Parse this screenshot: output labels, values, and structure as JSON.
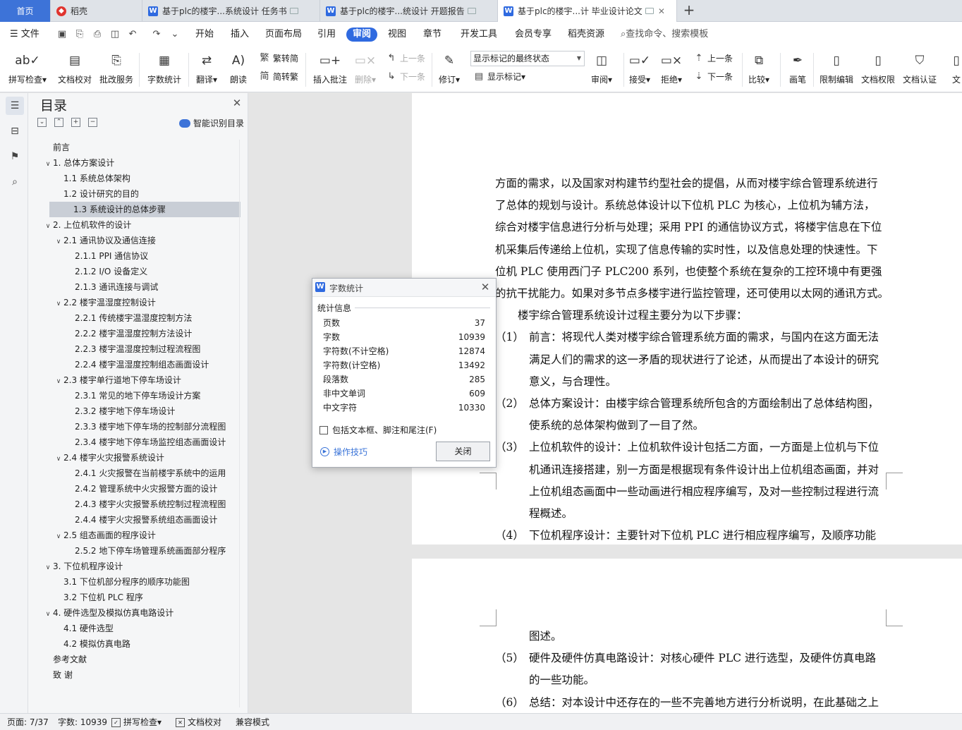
{
  "tabs": [
    {
      "label": "首页",
      "icon": "home"
    },
    {
      "label": "稻壳",
      "icon": "docer-icon"
    },
    {
      "label": "基于plc的楼宇...系统设计 任务书",
      "icon": "word-doc-icon"
    },
    {
      "label": "基于plc的楼宇...统设计 开题报告",
      "icon": "word-doc-icon"
    },
    {
      "label": "基于plc的楼宇...计 毕业设计论文",
      "icon": "word-doc-icon"
    }
  ],
  "menu": {
    "file": "文件",
    "items": [
      "开始",
      "插入",
      "页面布局",
      "引用",
      "审阅",
      "视图",
      "章节",
      "开发工具",
      "会员专享",
      "稻壳资源"
    ],
    "active": "审阅",
    "search": "查找命令、搜索模板"
  },
  "ribbon": {
    "spellcheck": "拼写检查",
    "doc_proof": "文档校对",
    "batch_review": "批改服务",
    "word_count": "字数统计",
    "translate": "翻译",
    "read_aloud": "朗读",
    "trad_convert": "繁转简",
    "simp_convert": "简转繁",
    "insert_comment": "插入批注",
    "delete": "删除",
    "prev_comment": "上一条",
    "next_comment": "下一条",
    "track_changes": "修订",
    "markup_state": "显示标记的最终状态",
    "show_markup": "显示标记",
    "review": "审阅",
    "accept": "接受",
    "reject": "拒绝",
    "prev_change": "上一条",
    "next_change": "下一条",
    "compare": "比较",
    "pen": "画笔",
    "restrict_edit": "限制编辑",
    "doc_rights": "文档权限",
    "doc_cert": "文档认证",
    "doc_more": "文"
  },
  "toc": {
    "title": "目录",
    "smart": "智能识别目录",
    "items": [
      {
        "text": "前言",
        "level": 0,
        "caret": false
      },
      {
        "text": "1. 总体方案设计",
        "level": 0,
        "caret": true
      },
      {
        "text": "1.1  系统总体架构",
        "level": 1,
        "caret": false
      },
      {
        "text": "1.2  设计研究的目的",
        "level": 1,
        "caret": false
      },
      {
        "text": "1.3  系统设计的总体步骤",
        "level": 1,
        "caret": false,
        "selected": true
      },
      {
        "text": "2. 上位机软件的设计",
        "level": 0,
        "caret": true
      },
      {
        "text": "2.1  通讯协议及通信连接",
        "level": 1,
        "caret": true
      },
      {
        "text": "2.1.1 PPI 通信协议",
        "level": 2,
        "caret": false
      },
      {
        "text": "2.1.2 I/O 设备定义",
        "level": 2,
        "caret": false
      },
      {
        "text": "2.1.3  通讯连接与调试",
        "level": 2,
        "caret": false
      },
      {
        "text": "2.2  楼宇温湿度控制设计",
        "level": 1,
        "caret": true
      },
      {
        "text": "2.2.1  传统楼宇温湿度控制方法",
        "level": 2,
        "caret": false
      },
      {
        "text": "2.2.2  楼宇温湿度控制方法设计",
        "level": 2,
        "caret": false
      },
      {
        "text": "2.2.3  楼宇温湿度控制过程流程图",
        "level": 2,
        "caret": false
      },
      {
        "text": "2.2.4  楼宇温湿度控制组态画面设计",
        "level": 2,
        "caret": false
      },
      {
        "text": "2.3  楼宇单行道地下停车场设计",
        "level": 1,
        "caret": true
      },
      {
        "text": "2.3.1  常见的地下停车场设计方案",
        "level": 2,
        "caret": false
      },
      {
        "text": "2.3.2  楼宇地下停车场设计",
        "level": 2,
        "caret": false
      },
      {
        "text": "2.3.3  楼宇地下停车场的控制部分流程图",
        "level": 2,
        "caret": false
      },
      {
        "text": "2.3.4  楼宇地下停车场监控组态画面设计",
        "level": 2,
        "caret": false
      },
      {
        "text": "2.4  楼宇火灾报警系统设计",
        "level": 1,
        "caret": true
      },
      {
        "text": "2.4.1  火灾报警在当前楼宇系统中的运用",
        "level": 2,
        "caret": false
      },
      {
        "text": "2.4.2  管理系统中火灾报警方面的设计",
        "level": 2,
        "caret": false
      },
      {
        "text": "2.4.3  楼宇火灾报警系统控制过程流程图",
        "level": 2,
        "caret": false
      },
      {
        "text": "2.4.4  楼宇火灾报警系统组态画面设计",
        "level": 2,
        "caret": false
      },
      {
        "text": "2.5  组态画面的程序设计",
        "level": 1,
        "caret": true
      },
      {
        "text": "2.5.2  地下停车场管理系统画面部分程序",
        "level": 2,
        "caret": false
      },
      {
        "text": "3. 下位机程序设计",
        "level": 0,
        "caret": true
      },
      {
        "text": "3.1  下位机部分程序的顺序功能图",
        "level": 1,
        "caret": false
      },
      {
        "text": "3.2  下位机 PLC 程序",
        "level": 1,
        "caret": false
      },
      {
        "text": "4. 硬件选型及模拟仿真电路设计",
        "level": 0,
        "caret": true
      },
      {
        "text": "4.1  硬件选型",
        "level": 1,
        "caret": false
      },
      {
        "text": "4.2  模拟仿真电路",
        "level": 1,
        "caret": false
      },
      {
        "text": "参考文献",
        "level": 0,
        "caret": false
      },
      {
        "text": "致    谢",
        "level": 0,
        "caret": false
      }
    ]
  },
  "document": {
    "page1_lines": [
      {
        "text": "方面的需求，以及国家对构建节约型社会的提倡，从而对楼宇综合管理系统进行",
        "kind": "plain"
      },
      {
        "text": "了总体的规划与设计。系统总体设计以下位机 PLC 为核心，上位机为辅方法，",
        "kind": "plain"
      },
      {
        "text": "综合对楼宇信息进行分析与处理；采用 PPI 的通信协议方式，将楼宇信息在下位",
        "kind": "plain"
      },
      {
        "text": "机采集后传递给上位机，实现了信息传输的实时性，以及信息处理的快速性。下",
        "kind": "plain"
      },
      {
        "text": "位机 PLC 使用西门子 PLC200 系列，也使整个系统在复杂的工控环境中有更强",
        "kind": "plain"
      },
      {
        "text": "的抗干扰能力。如果对多节点多楼宇进行监控管理，还可使用以太网的通讯方式。",
        "kind": "plain"
      },
      {
        "text": "楼宇综合管理系统设计过程主要分为以下步骤：",
        "kind": "ind"
      },
      {
        "num": "（1）",
        "text": "前言：将现代人类对楼宇综合管理系统方面的需求，与国内在这方面无法",
        "kind": "numbered"
      },
      {
        "text": "满足人们的需求的这一矛盾的现状进行了论述，从而提出了本设计的研究",
        "kind": "cont"
      },
      {
        "text": "意义，与合理性。",
        "kind": "cont"
      },
      {
        "num": "（2）",
        "text": "总体方案设计：由楼宇综合管理系统所包含的方面绘制出了总体结构图，",
        "kind": "numbered"
      },
      {
        "text": "使系统的总体架构做到了一目了然。",
        "kind": "cont"
      },
      {
        "num": "（3）",
        "text": "上位机软件的设计：上位机软件设计包括二方面，一方面是上位机与下位",
        "kind": "numbered"
      },
      {
        "text": "机通讯连接搭建，别一方面是根据现有条件设计出上位机组态画面，并对",
        "kind": "cont"
      },
      {
        "text": "上位机组态画面中一些动画进行相应程序编写，及对一些控制过程进行流",
        "kind": "cont"
      },
      {
        "text": "程概述。",
        "kind": "cont"
      },
      {
        "num": "（4）",
        "text": "下位机程序设计：主要针对下位机 PLC 进行相应程序编写，及顺序功能",
        "kind": "numbered"
      }
    ],
    "page_number": "7",
    "page2_lines": [
      {
        "text": "图述。",
        "kind": "cont"
      },
      {
        "num": "（5）",
        "text": "硬件及硬件仿真电路设计：对核心硬件 PLC 进行选型，及硬件仿真电路",
        "kind": "numbered"
      },
      {
        "text": "的一些功能。",
        "kind": "cont"
      },
      {
        "num": "（6）",
        "text": "总结：对本设计中还存在的一些不完善地方进行分析说明，在此基础之上",
        "kind": "numbered"
      }
    ]
  },
  "dialog": {
    "title": "字数统计",
    "group": "统计信息",
    "stats": [
      {
        "label": "页数",
        "value": "37"
      },
      {
        "label": "字数",
        "value": "10939"
      },
      {
        "label": "字符数(不计空格)",
        "value": "12874"
      },
      {
        "label": "字符数(计空格)",
        "value": "13492"
      },
      {
        "label": "段落数",
        "value": "285"
      },
      {
        "label": "非中文单词",
        "value": "609"
      },
      {
        "label": "中文字符",
        "value": "10330"
      }
    ],
    "include_label": "包括文本框、脚注和尾注(F)",
    "tips": "操作技巧",
    "close": "关闭"
  },
  "status": {
    "page": "页面: 7/37",
    "words": "字数: 10939",
    "spell": "拼写检查",
    "proof": "文档校对",
    "compat": "兼容模式"
  }
}
